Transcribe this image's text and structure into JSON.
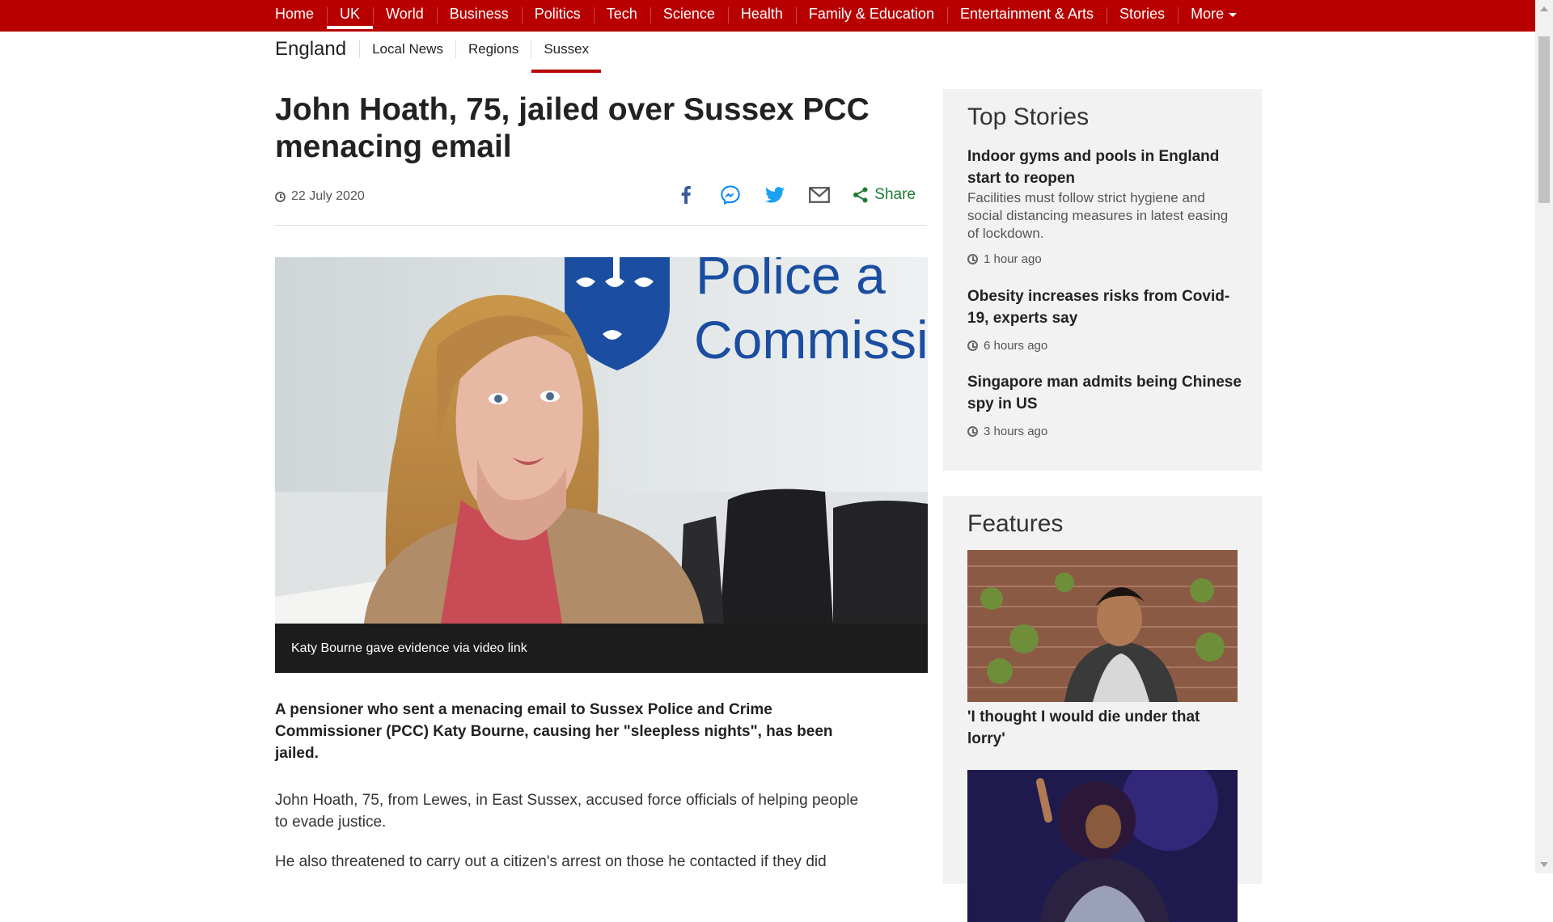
{
  "top_nav": {
    "items": [
      {
        "label": "Home"
      },
      {
        "label": "UK"
      },
      {
        "label": "World"
      },
      {
        "label": "Business"
      },
      {
        "label": "Politics"
      },
      {
        "label": "Tech"
      },
      {
        "label": "Science"
      },
      {
        "label": "Health"
      },
      {
        "label": "Family & Education"
      },
      {
        "label": "Entertainment & Arts"
      },
      {
        "label": "Stories"
      },
      {
        "label": "More"
      }
    ],
    "active": "UK",
    "bg_color": "#b80000"
  },
  "sub_nav": {
    "title": "England",
    "items": [
      {
        "label": "Local News"
      },
      {
        "label": "Regions"
      },
      {
        "label": "Sussex"
      }
    ],
    "active": "Sussex"
  },
  "article": {
    "headline": "John Hoath, 75, jailed over Sussex PCC menacing email",
    "date": "22 July 2020",
    "share_label": "Share",
    "share_icons": [
      "facebook-icon",
      "messenger-icon",
      "twitter-icon",
      "email-icon",
      "share-icon"
    ],
    "image_text": {
      "line1": "Police a",
      "line2": "Commissi"
    },
    "caption": "Katy Bourne gave evidence via video link",
    "intro": "A pensioner who sent a menacing email to Sussex Police and Crime Commissioner (PCC) Katy Bourne, causing her \"sleepless nights\", has been jailed.",
    "paragraphs": [
      "John Hoath, 75, from Lewes, in East Sussex, accused force officials of helping people to evade justice.",
      "He also threatened to carry out a citizen's arrest on those he contacted if they did"
    ]
  },
  "sidebar": {
    "top_stories": {
      "title": "Top Stories",
      "stories": [
        {
          "title": "Indoor gyms and pools in England start to reopen",
          "summary": "Facilities must follow strict hygiene and social distancing measures in latest easing of lockdown.",
          "time": "1 hour ago"
        },
        {
          "title": "Obesity increases risks from Covid-19, experts say",
          "time": "6 hours ago"
        },
        {
          "title": "Singapore man admits being Chinese spy in US",
          "time": "3 hours ago"
        }
      ]
    },
    "features": {
      "title": "Features",
      "items": [
        {
          "title": "'I thought I would die under that lorry'"
        }
      ]
    }
  },
  "colors": {
    "accent_red": "#b80000",
    "share_green": "#1e7b34",
    "facebook_blue": "#3b5998",
    "messenger_blue": "#0084ff",
    "twitter_blue": "#1da1f2"
  }
}
